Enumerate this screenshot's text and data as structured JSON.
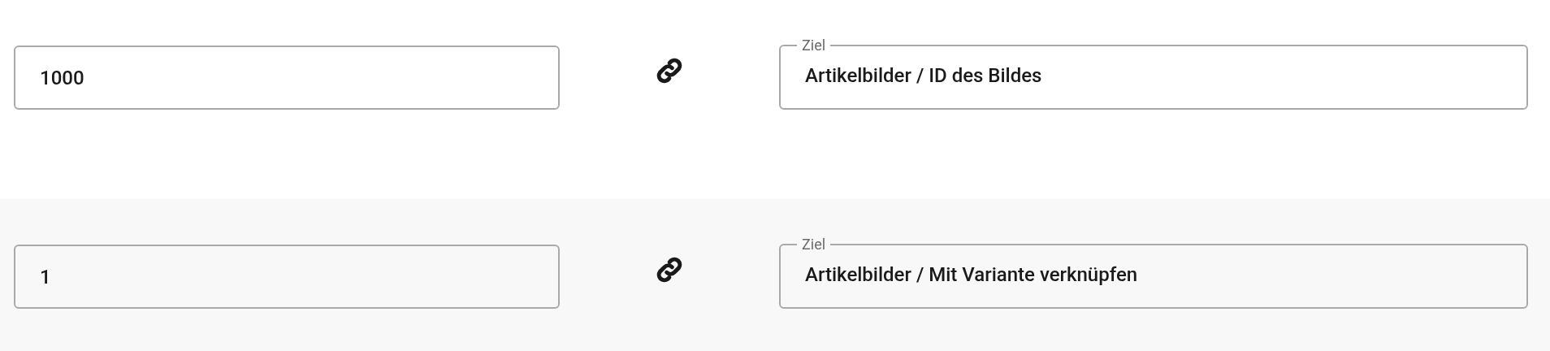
{
  "mappings": [
    {
      "source_value": "1000",
      "target": {
        "label": "Ziel",
        "value": "Artikelbilder / ID des Bildes"
      }
    },
    {
      "source_value": "1",
      "target": {
        "label": "Ziel",
        "value": "Artikelbilder / Mit Variante verknüpfen"
      }
    }
  ]
}
